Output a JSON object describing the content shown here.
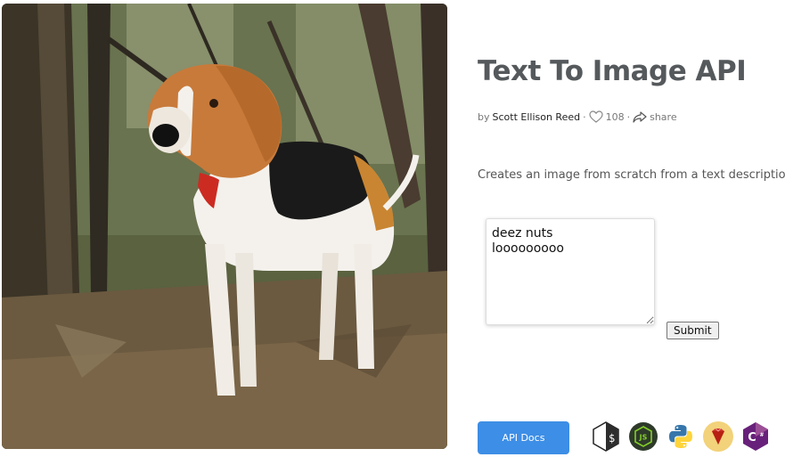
{
  "page": {
    "title": "Text To Image API",
    "byline": {
      "prefix": "by",
      "author": "Scott Ellison Reed",
      "separator": "·",
      "likes": "108",
      "share_label": "share"
    },
    "description": "Creates an image from scratch from a text description."
  },
  "hero_image": {
    "subject": "beagle-dog-in-forest",
    "icon": "dog-photo"
  },
  "form": {
    "prompt_value": "deez nuts\nlooooooooo",
    "submit_label": "Submit"
  },
  "footer": {
    "api_docs_label": "API Docs",
    "languages": [
      {
        "name": "shell",
        "icon": "terminal-icon"
      },
      {
        "name": "nodejs",
        "icon": "nodejs-icon"
      },
      {
        "name": "python",
        "icon": "python-icon"
      },
      {
        "name": "ruby",
        "icon": "ruby-icon"
      },
      {
        "name": "csharp",
        "icon": "csharp-icon"
      }
    ]
  },
  "colors": {
    "title": "#55595c",
    "accent_button": "#3d8ee6",
    "nodejs_bg": "#2e3a2a",
    "nodejs_green": "#83cd29",
    "python_blue": "#3776ab",
    "python_yellow": "#ffd43b",
    "ruby_bg": "#f2d27a",
    "ruby_red": "#cc342d",
    "csharp_purple": "#68217a"
  }
}
